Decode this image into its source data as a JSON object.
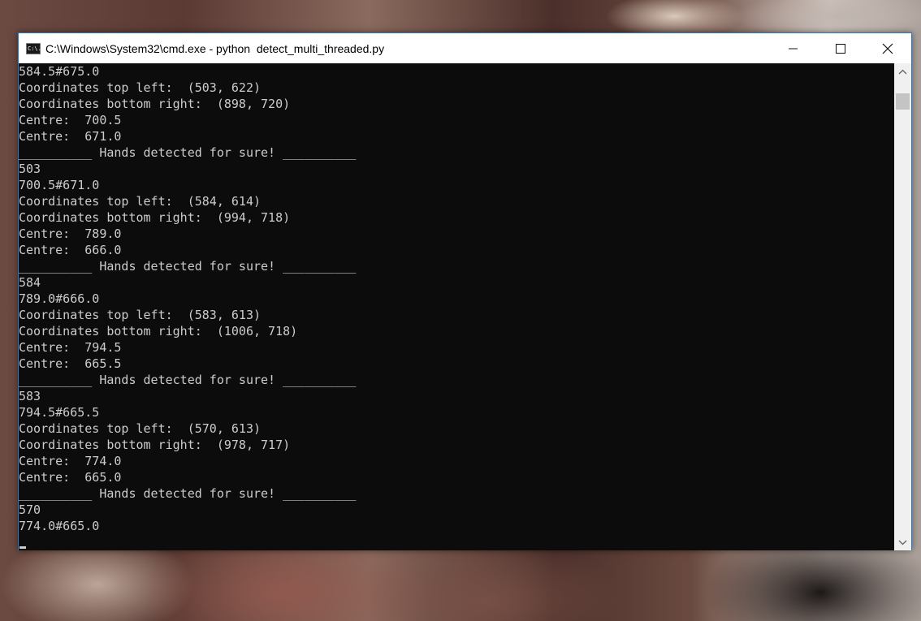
{
  "window": {
    "title": "C:\\Windows\\System32\\cmd.exe - python  detect_multi_threaded.py",
    "icon_name": "cmd-icon",
    "icon_text": "C:\\.",
    "controls": [
      "minimize-icon",
      "maximize-icon",
      "close-icon"
    ]
  },
  "console": {
    "lines": [
      "584.5#675.0",
      "Coordinates top left:  (503, 622)",
      "Coordinates bottom right:  (898, 720)",
      "Centre:  700.5",
      "Centre:  671.0",
      "__________ Hands detected for sure! __________",
      "503",
      "700.5#671.0",
      "Coordinates top left:  (584, 614)",
      "Coordinates bottom right:  (994, 718)",
      "Centre:  789.0",
      "Centre:  666.0",
      "__________ Hands detected for sure! __________",
      "584",
      "789.0#666.0",
      "Coordinates top left:  (583, 613)",
      "Coordinates bottom right:  (1006, 718)",
      "Centre:  794.5",
      "Centre:  665.5",
      "__________ Hands detected for sure! __________",
      "583",
      "794.5#665.5",
      "Coordinates top left:  (570, 613)",
      "Coordinates bottom right:  (978, 717)",
      "Centre:  774.0",
      "Centre:  665.0",
      "__________ Hands detected for sure! __________",
      "570",
      "774.0#665.0"
    ]
  },
  "colors": {
    "console_bg": "#0c0c0c",
    "console_text": "#cccccc",
    "titlebar_bg": "#ffffff",
    "window_border": "#2d77c8"
  }
}
